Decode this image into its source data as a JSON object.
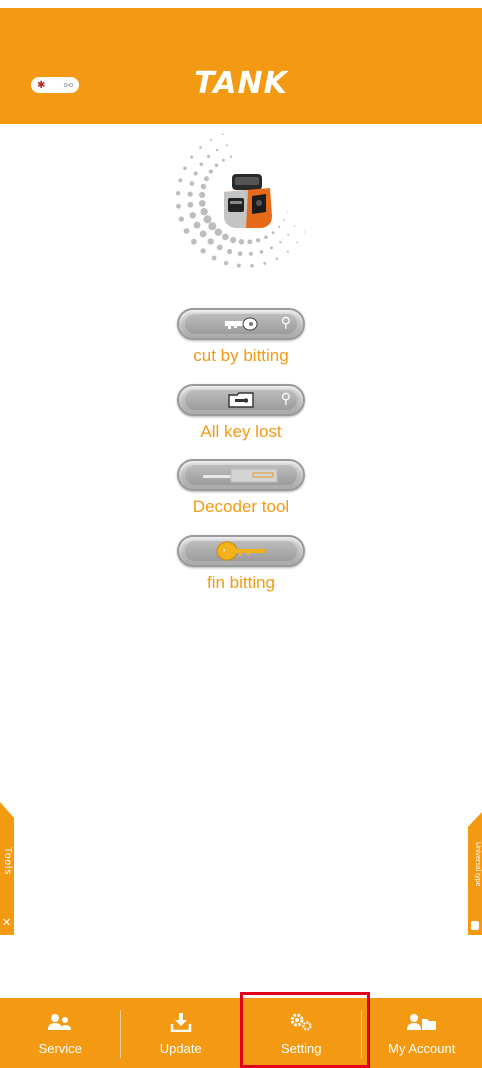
{
  "header": {
    "logo_text": "TANK",
    "color": "#F39A12"
  },
  "machine": {
    "icon": "key-cutting-machine-icon"
  },
  "menu": [
    {
      "label": "cut by bitting",
      "icon": "key-icon"
    },
    {
      "label": "All key lost",
      "icon": "folder-key-icon"
    },
    {
      "label": "Decoder tool",
      "icon": "decoder-tool-icon"
    },
    {
      "label": "fin bitting",
      "icon": "gold-key-icon"
    }
  ],
  "side_tabs": {
    "left": "Tools",
    "right": "Universal type"
  },
  "bottom_nav": [
    {
      "label": "Service",
      "icon": "users-icon"
    },
    {
      "label": "Update",
      "icon": "download-icon"
    },
    {
      "label": "Setting",
      "icon": "gear-icon"
    },
    {
      "label": "My Account",
      "icon": "account-icon"
    }
  ],
  "highlight_color": "#E3001B"
}
